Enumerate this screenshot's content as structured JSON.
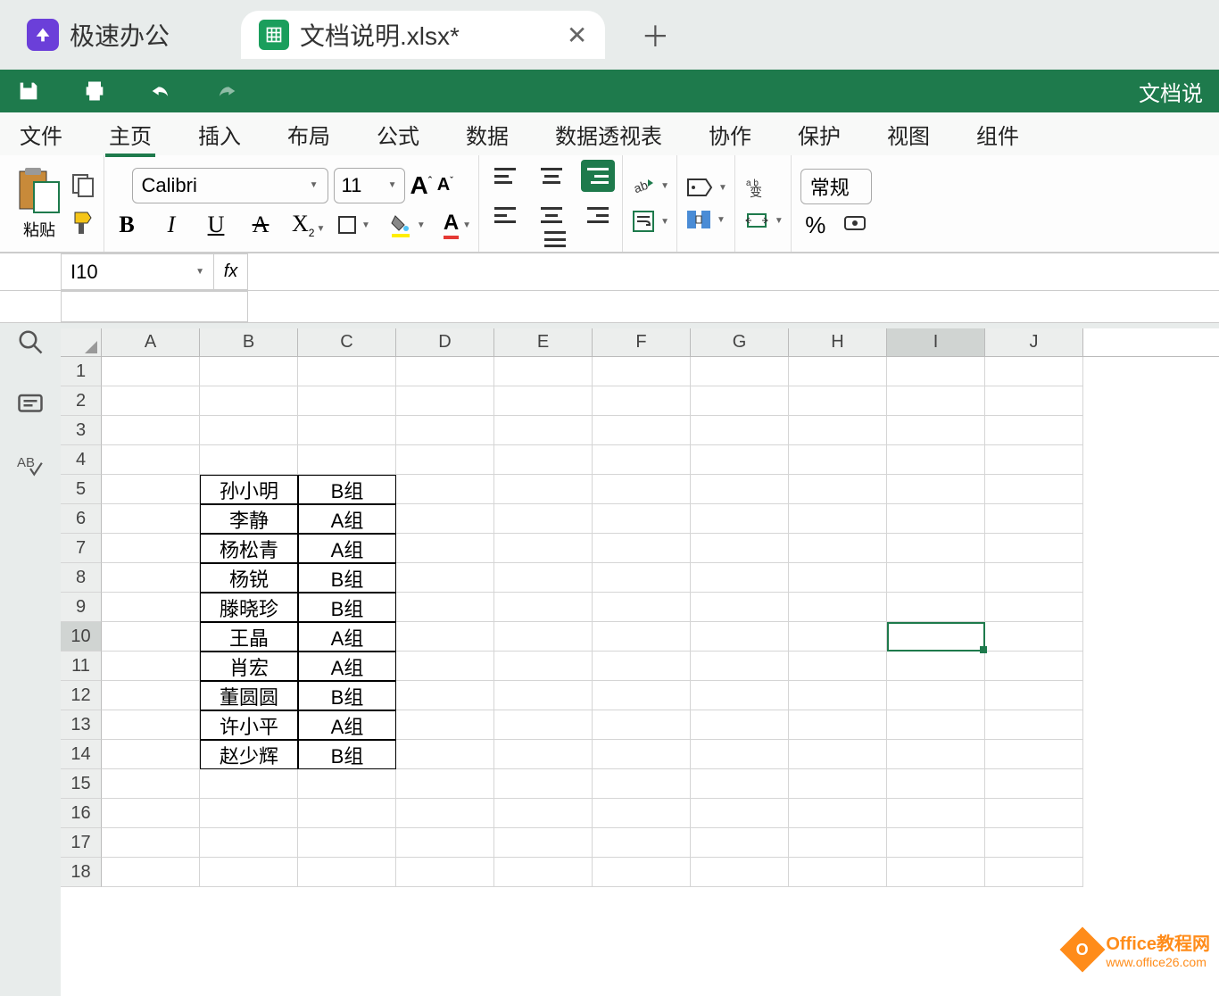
{
  "app_name": "极速办公",
  "document_tab": "文档说明.xlsx*",
  "doc_title_right": "文档说",
  "toolbar": {
    "save": "保存",
    "print": "打印",
    "undo": "撤销",
    "redo": "重做"
  },
  "menu": {
    "file": "文件",
    "home": "主页",
    "insert": "插入",
    "layout": "布局",
    "formula": "公式",
    "data": "数据",
    "pivot": "数据透视表",
    "collab": "协作",
    "protect": "保护",
    "view": "视图",
    "component": "组件"
  },
  "ribbon": {
    "paste": "粘贴",
    "font_name": "Calibri",
    "font_size": "11",
    "number_format": "常规",
    "percent": "%"
  },
  "name_box": "I10",
  "fx_label": "fx",
  "columns": [
    "A",
    "B",
    "C",
    "D",
    "E",
    "F",
    "G",
    "H",
    "I",
    "J"
  ],
  "chart_data": {
    "type": "table",
    "rows": [
      {
        "row": 5,
        "B": "孙小明",
        "C": "B组"
      },
      {
        "row": 6,
        "B": "李静",
        "C": "A组"
      },
      {
        "row": 7,
        "B": "杨松青",
        "C": "A组"
      },
      {
        "row": 8,
        "B": "杨锐",
        "C": "B组"
      },
      {
        "row": 9,
        "B": "滕晓珍",
        "C": "B组"
      },
      {
        "row": 10,
        "B": "王晶",
        "C": "A组"
      },
      {
        "row": 11,
        "B": "肖宏",
        "C": "A组"
      },
      {
        "row": 12,
        "B": "董圆圆",
        "C": "B组"
      },
      {
        "row": 13,
        "B": "许小平",
        "C": "A组"
      },
      {
        "row": 14,
        "B": "赵少辉",
        "C": "B组"
      }
    ]
  },
  "active_cell": "I10",
  "active_row": 10,
  "active_col": "I",
  "watermark": {
    "title": "Office教程网",
    "url": "www.office26.com"
  }
}
